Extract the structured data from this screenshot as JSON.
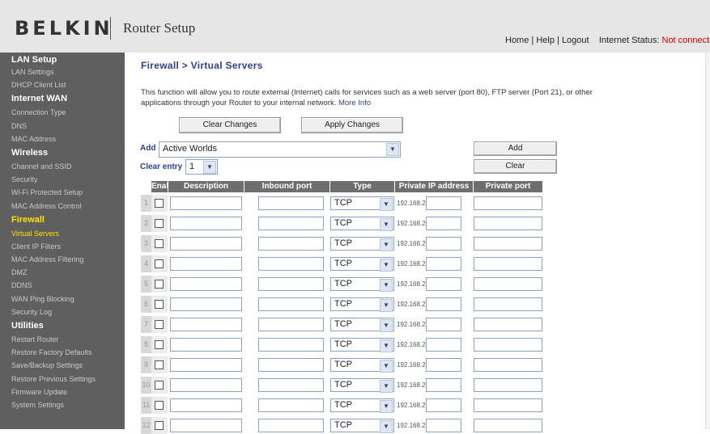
{
  "header": {
    "brand": "BELKIN",
    "title": "Router Setup",
    "links": {
      "home": "Home",
      "help": "Help",
      "logout": "Logout",
      "sep": "|"
    },
    "status_label": "Internet Status:",
    "status_value": "Not connected",
    "status_color": "#d40000"
  },
  "sidebar": {
    "lan_setup": "LAN Setup",
    "lan_settings": "LAN Settings",
    "dhcp_client_list": "DHCP Client List",
    "internet_wan": "Internet WAN",
    "connection_type": "Connection Type",
    "dns": "DNS",
    "mac_address": "MAC Address",
    "wireless": "Wireless",
    "channel_ssid": "Channel and SSID",
    "security": "Security",
    "wifi_protected_setup": "Wi-Fi Protected Setup",
    "mac_address_control": "MAC Address Control",
    "firewall": "Firewall",
    "virtual_servers": "Virtual Servers",
    "client_ip_filters": "Client IP Filters",
    "mac_address_filtering": "MAC Address Filtering",
    "dmz": "DMZ",
    "ddns": "DDNS",
    "wan_ping_blocking": "WAN Ping Blocking",
    "security_log": "Security Log",
    "utilities": "Utilities",
    "restart_router": "Restart Router",
    "restore_factory_defaults": "Restore Factory Defaults",
    "save_backup_settings": "Save/Backup Settings",
    "restore_previous_settings": "Restore Previous Settings",
    "firmware_update": "Firmware Update",
    "system_settings": "System Settings",
    "active_color": "#ffe100"
  },
  "main": {
    "page_title": "Firewall > Virtual Servers",
    "intro": "This function will allow you to route external (Internet) calls for services such as a web server (port 80), FTP server (Port 21), or other applications through your Router to your internal network.",
    "more_info": "More Info",
    "clear_changes": "Clear Changes",
    "apply_changes": "Apply Changes",
    "add_label": "Add",
    "add_selected": "Active Worlds",
    "add_button": "Add",
    "clear_entry_label": "Clear entry",
    "clear_entry_selected": "1",
    "clear_button": "Clear"
  },
  "table": {
    "headers": {
      "enable": "Enable",
      "description": "Description",
      "inbound_port": "Inbound port",
      "type": "Type",
      "private_ip": "Private IP address",
      "private_port": "Private port"
    },
    "rows": [
      {
        "num": "1",
        "type": "TCP",
        "ip_prefix": "192.168.2."
      },
      {
        "num": "2",
        "type": "TCP",
        "ip_prefix": "192.168.2."
      },
      {
        "num": "3",
        "type": "TCP",
        "ip_prefix": "192.168.2."
      },
      {
        "num": "4",
        "type": "TCP",
        "ip_prefix": "192.168.2."
      },
      {
        "num": "5",
        "type": "TCP",
        "ip_prefix": "192.168.2."
      },
      {
        "num": "6",
        "type": "TCP",
        "ip_prefix": "192.168.2."
      },
      {
        "num": "7",
        "type": "TCP",
        "ip_prefix": "192.168.2."
      },
      {
        "num": "8",
        "type": "TCP",
        "ip_prefix": "192.168.2."
      },
      {
        "num": "9",
        "type": "TCP",
        "ip_prefix": "192.168.2."
      },
      {
        "num": "10",
        "type": "TCP",
        "ip_prefix": "192.168.2."
      },
      {
        "num": "11",
        "type": "TCP",
        "ip_prefix": "192.168.2."
      },
      {
        "num": "12",
        "type": "TCP",
        "ip_prefix": "192.168.2."
      }
    ]
  }
}
